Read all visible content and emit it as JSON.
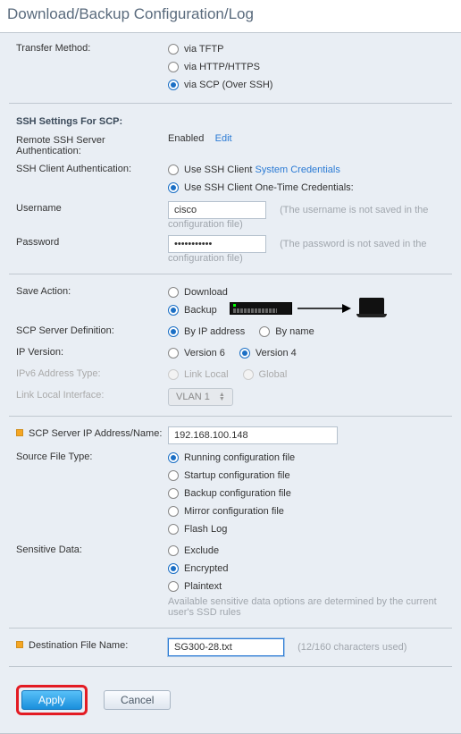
{
  "title": "Download/Backup Configuration/Log",
  "transfer": {
    "label": "Transfer Method:",
    "options": {
      "tftp": "via TFTP",
      "http": "via HTTP/HTTPS",
      "scp": "via SCP (Over SSH)"
    },
    "selected": "scp"
  },
  "ssh": {
    "section": "SSH Settings For SCP:",
    "remoteAuth": {
      "label": "Remote SSH Server Authentication:",
      "status": "Enabled",
      "edit": "Edit"
    },
    "clientAuth": {
      "label": "SSH Client Authentication:",
      "sys": {
        "prefix": "Use SSH Client ",
        "link": "System Credentials"
      },
      "onetime": "Use SSH Client One-Time Credentials:",
      "selected": "onetime"
    },
    "username": {
      "label": "Username",
      "value": "cisco",
      "hint": "(The username is not saved in the configuration file)"
    },
    "password": {
      "label": "Password",
      "value": "•••••••••••",
      "hint": "(The password is not saved in the configuration file)"
    }
  },
  "save": {
    "label": "Save Action:",
    "options": {
      "download": "Download",
      "backup": "Backup"
    },
    "selected": "backup"
  },
  "scpDef": {
    "label": "SCP Server Definition:",
    "ip": "By IP address",
    "name": "By name",
    "selected": "ip"
  },
  "ipver": {
    "label": "IP Version:",
    "v6": "Version 6",
    "v4": "Version 4",
    "selected": "v4"
  },
  "v6type": {
    "label": "IPv6 Address Type:",
    "ll": "Link Local",
    "gl": "Global"
  },
  "llif": {
    "label": "Link Local Interface:",
    "value": "VLAN 1"
  },
  "serverIP": {
    "label": "SCP Server IP Address/Name:",
    "value": "192.168.100.148"
  },
  "srcType": {
    "label": "Source File Type:",
    "opts": {
      "run": "Running configuration file",
      "start": "Startup configuration file",
      "back": "Backup configuration file",
      "mirror": "Mirror configuration file",
      "flash": "Flash Log"
    },
    "selected": "run"
  },
  "sensitive": {
    "label": "Sensitive Data:",
    "opts": {
      "excl": "Exclude",
      "enc": "Encrypted",
      "plain": "Plaintext"
    },
    "selected": "enc",
    "note": "Available sensitive data options are determined by the current user's SSD rules"
  },
  "dest": {
    "label": "Destination File Name:",
    "value": "SG300-28.txt",
    "hint": "(12/160 characters used)"
  },
  "buttons": {
    "apply": "Apply",
    "cancel": "Cancel"
  }
}
